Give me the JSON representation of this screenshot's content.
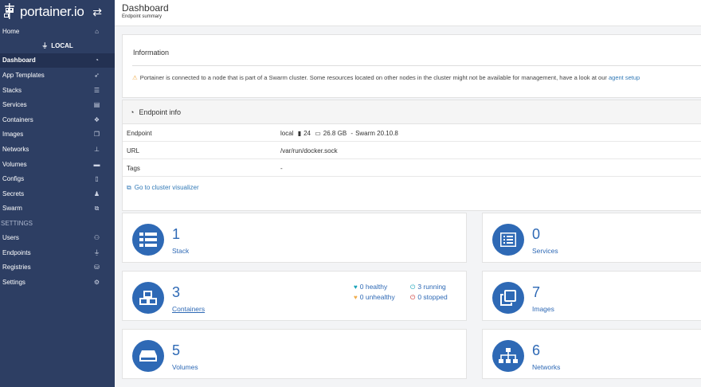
{
  "sidebar": {
    "logo_text": "portainer.io",
    "local_label": "LOCAL",
    "settings_label": "SETTINGS",
    "items": [
      {
        "label": "Home",
        "icon": "home-icon"
      },
      {
        "label": "Dashboard",
        "icon": "tachometer-icon"
      },
      {
        "label": "App Templates",
        "icon": "rocket-icon"
      },
      {
        "label": "Stacks",
        "icon": "list-icon"
      },
      {
        "label": "Services",
        "icon": "list-alt-icon"
      },
      {
        "label": "Containers",
        "icon": "cubes-icon"
      },
      {
        "label": "Images",
        "icon": "clone-icon"
      },
      {
        "label": "Networks",
        "icon": "sitemap-icon"
      },
      {
        "label": "Volumes",
        "icon": "hdd-icon"
      },
      {
        "label": "Configs",
        "icon": "file-icon"
      },
      {
        "label": "Secrets",
        "icon": "user-secret-icon"
      },
      {
        "label": "Swarm",
        "icon": "object-group-icon"
      }
    ],
    "settings_items": [
      {
        "label": "Users",
        "icon": "users-icon"
      },
      {
        "label": "Endpoints",
        "icon": "plug-icon"
      },
      {
        "label": "Registries",
        "icon": "database-icon"
      },
      {
        "label": "Settings",
        "icon": "cogs-icon"
      }
    ]
  },
  "header": {
    "title": "Dashboard",
    "subtitle": "Endpoint summary"
  },
  "information": {
    "title": "Information",
    "text": "Portainer is connected to a node that is part of a Swarm cluster. Some resources located on other nodes in the cluster might not be available for management, have a look at our",
    "link_text": "agent setup"
  },
  "endpoint_info": {
    "title": "Endpoint info",
    "rows": {
      "endpoint": {
        "key": "Endpoint",
        "name": "local",
        "cpu": "24",
        "memory": "26.8 GB",
        "version": "Swarm 20.10.8"
      },
      "url": {
        "key": "URL",
        "value": "/var/run/docker.sock"
      },
      "tags": {
        "key": "Tags",
        "value": "-"
      }
    },
    "visualizer_link": "Go to cluster visualizer"
  },
  "cards": {
    "stack": {
      "count": "1",
      "label": "Stack",
      "icon": "list-icon"
    },
    "services": {
      "count": "0",
      "label": "Services",
      "icon": "list-alt-icon"
    },
    "containers": {
      "count": "3",
      "label": "Containers",
      "icon": "cubes-icon",
      "healthy": "0 healthy",
      "unhealthy": "0 unhealthy",
      "running": "3 running",
      "stopped": "0 stopped"
    },
    "images": {
      "count": "7",
      "label": "Images",
      "icon": "clone-icon"
    },
    "volumes": {
      "count": "5",
      "label": "Volumes",
      "icon": "hdd-icon"
    },
    "networks": {
      "count": "6",
      "label": "Networks",
      "icon": "sitemap-icon"
    }
  },
  "colors": {
    "sidebar_bg": "#2d3e63",
    "accent": "#2e69b5",
    "healthy": "#17a2b8",
    "unhealthy": "#f0ad4e",
    "running": "#17a2b8",
    "stopped": "#c9302c"
  }
}
